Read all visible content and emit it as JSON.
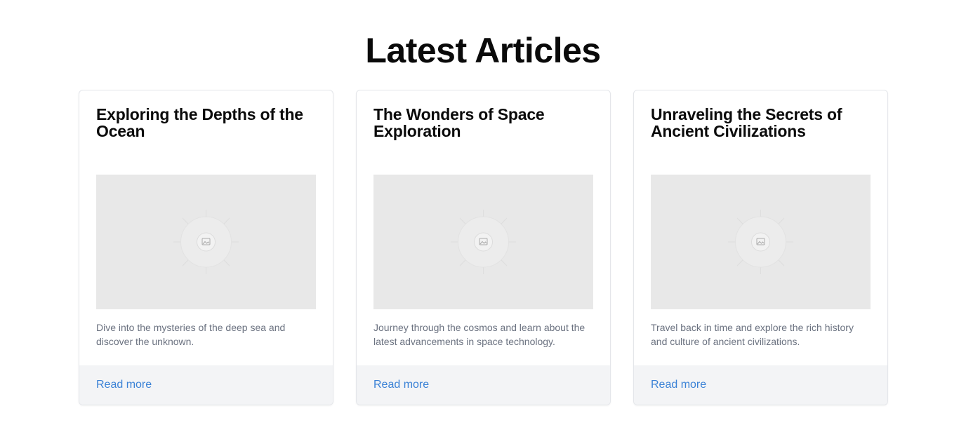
{
  "page": {
    "title": "Latest Articles"
  },
  "articles": [
    {
      "title": "Exploring the Depths of the Ocean",
      "description": "Dive into the mysteries of the deep sea and discover the unknown.",
      "link_label": "Read more",
      "image_icon": "image-placeholder-icon"
    },
    {
      "title": "The Wonders of Space Exploration",
      "description": "Journey through the cosmos and learn about the latest advancements in space technology.",
      "link_label": "Read more",
      "image_icon": "image-placeholder-icon"
    },
    {
      "title": "Unraveling the Secrets of Ancient Civilizations",
      "description": "Travel back in time and explore the rich history and culture of ancient civilizations.",
      "link_label": "Read more",
      "image_icon": "image-placeholder-icon"
    }
  ],
  "colors": {
    "link": "#3b82d6",
    "footer_bg": "#f3f4f6",
    "image_bg": "#e8e8e8",
    "muted_text": "#6b7280"
  }
}
